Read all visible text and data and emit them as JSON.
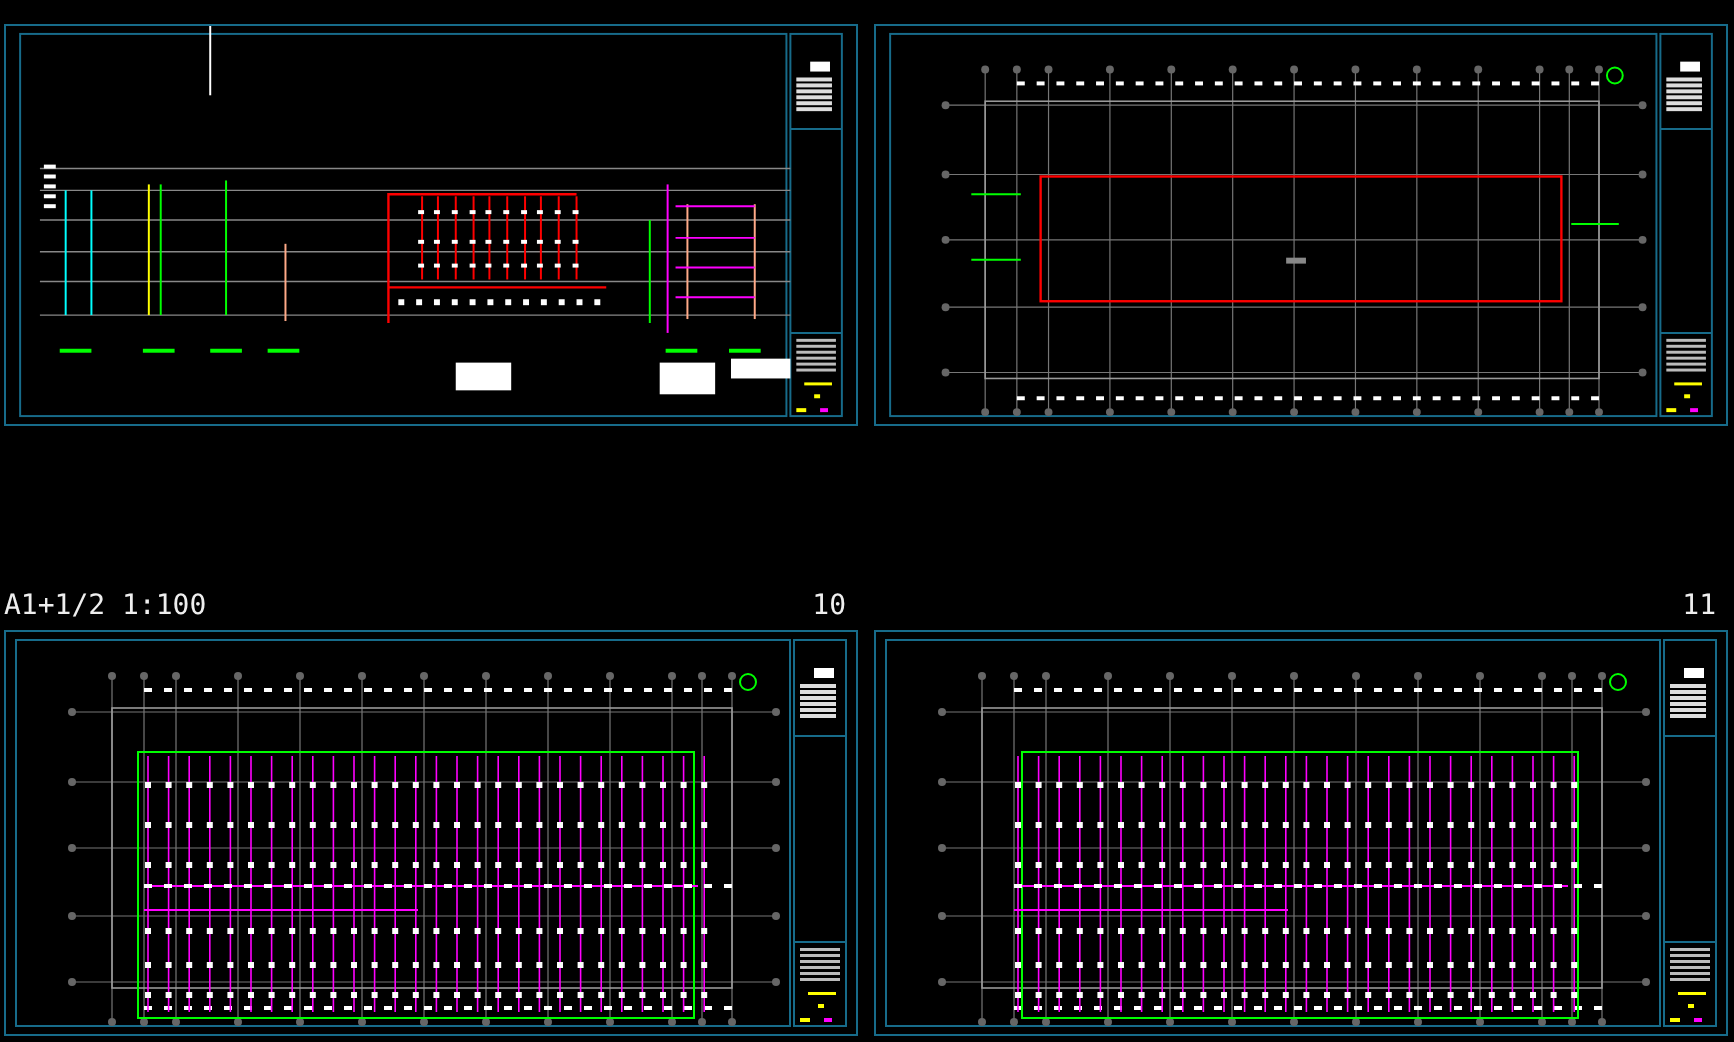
{
  "sheets": [
    {
      "kind": "system-diagram"
    },
    {
      "kind": "fire-plan"
    },
    {
      "kind": "sprinkler-plan",
      "scale_label": "A1+1/2 1:100",
      "number": "10"
    },
    {
      "kind": "sprinkler-plan-alt",
      "number": "11"
    }
  ]
}
